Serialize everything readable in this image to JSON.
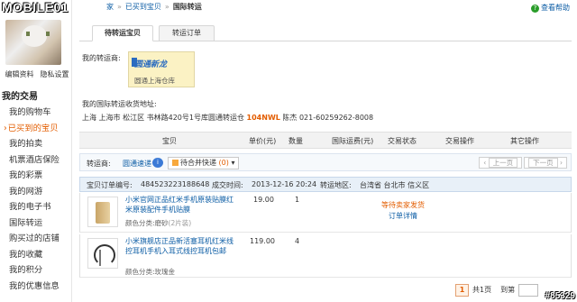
{
  "watermark": "MOBILE01",
  "watermark_badge": "#85329",
  "breadcrumb": {
    "prev": "家",
    "link": "已买到宝贝",
    "current": "国际转运"
  },
  "help": {
    "icon": "help-circle-icon",
    "label": "查看帮助"
  },
  "sidebar": {
    "edit_profile": "编辑资料",
    "privacy": "隐私设置",
    "heading": "我的交易",
    "items": [
      {
        "label": "我的购物车"
      },
      {
        "label": "已买到的宝贝",
        "active": true
      },
      {
        "label": "我的拍卖"
      },
      {
        "label": "机票酒店保险"
      },
      {
        "label": "我的彩票"
      },
      {
        "label": "我的网游"
      },
      {
        "label": "我的电子书"
      },
      {
        "label": "国际转运"
      },
      {
        "label": "购买过的店铺"
      },
      {
        "label": "我的收藏"
      },
      {
        "label": "我的积分"
      },
      {
        "label": "我的优惠信息"
      }
    ]
  },
  "tabs": [
    {
      "label": "待转运宝贝",
      "active": true
    },
    {
      "label": "转运订单"
    }
  ],
  "forwarder_label": "我的转运商:",
  "forwarder_logo": {
    "brand": "圆通新龙",
    "caption": "圆通上海仓库"
  },
  "address_label": "我的国际转运收货地址:",
  "address": {
    "text": "上海 上海市 松江区 书林路420号1号库圆通转运仓",
    "code": "104NWL",
    "tail": "陈杰 021-60259262-8008"
  },
  "table_header": {
    "item": "宝贝",
    "price": "单价(元)",
    "qty": "数量",
    "intl_shipping": "国际运费(元)",
    "trade_status": "交易状态",
    "trade_action": "交易操作",
    "other_action": "其它操作"
  },
  "forwarder_row": {
    "label": "转运商:",
    "value": "圆通速递",
    "merge_label": "待合并快递",
    "merge_count": "(0)",
    "prev_page": "上一页",
    "next_page": "下一页"
  },
  "order": {
    "number_label": "宝贝订单编号:",
    "number": "484523223188648",
    "deal_time_label": "成交时间:",
    "deal_time": "2013-12-16 20:24",
    "region_label": "转运地区:",
    "region": "台湾省 台北市 信义区",
    "items": [
      {
        "title": "小米官网正品红米手机原装贴膜红米原装配件手机贴膜",
        "color_label": "颜色分类:",
        "color": "磨砂",
        "qty_note": "(2片装)",
        "price": "19.00",
        "qty": "1",
        "status_1": "等待卖家发货",
        "status_2": "订单详情"
      },
      {
        "title": "小米旗舰店正品新活塞耳机红米线控耳机手机入耳式线控耳机包邮",
        "color_label": "颜色分类:",
        "color": "玫瑰金",
        "qty_note": "",
        "price": "119.00",
        "qty": "4"
      }
    ]
  },
  "pagination": {
    "current": "1",
    "total": "共1页",
    "goto": "到第"
  },
  "colors": {
    "link": "#0c5da5",
    "accent": "#e35d00",
    "header_bg": "#f2f2f2"
  }
}
